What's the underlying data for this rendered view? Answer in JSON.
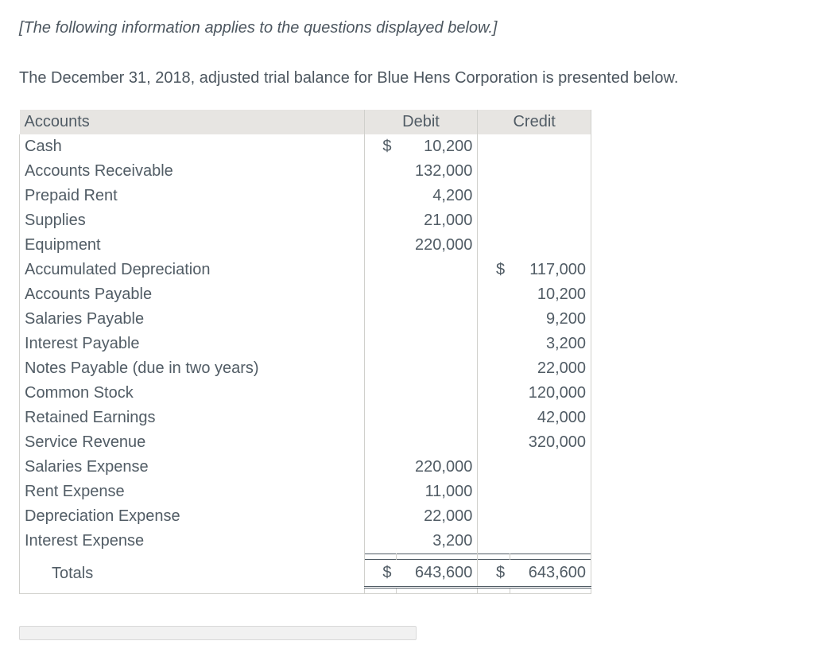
{
  "intro": "[The following information applies to the questions displayed below.]",
  "narrative": "The December 31, 2018, adjusted trial balance for Blue Hens Corporation is presented below.",
  "chart_data": {
    "type": "table",
    "title": "Adjusted Trial Balance",
    "columns": [
      "Accounts",
      "Debit",
      "Credit"
    ],
    "rows": [
      {
        "account": "Cash",
        "debit": 10200,
        "credit": null
      },
      {
        "account": "Accounts Receivable",
        "debit": 132000,
        "credit": null
      },
      {
        "account": "Prepaid Rent",
        "debit": 4200,
        "credit": null
      },
      {
        "account": "Supplies",
        "debit": 21000,
        "credit": null
      },
      {
        "account": "Equipment",
        "debit": 220000,
        "credit": null
      },
      {
        "account": "Accumulated Depreciation",
        "debit": null,
        "credit": 117000
      },
      {
        "account": "Accounts Payable",
        "debit": null,
        "credit": 10200
      },
      {
        "account": "Salaries Payable",
        "debit": null,
        "credit": 9200
      },
      {
        "account": "Interest Payable",
        "debit": null,
        "credit": 3200
      },
      {
        "account": "Notes Payable (due in two years)",
        "debit": null,
        "credit": 22000
      },
      {
        "account": "Common Stock",
        "debit": null,
        "credit": 120000
      },
      {
        "account": "Retained Earnings",
        "debit": null,
        "credit": 42000
      },
      {
        "account": "Service Revenue",
        "debit": null,
        "credit": 320000
      },
      {
        "account": "Salaries Expense",
        "debit": 220000,
        "credit": null
      },
      {
        "account": "Rent Expense",
        "debit": 11000,
        "credit": null
      },
      {
        "account": "Depreciation Expense",
        "debit": 22000,
        "credit": null
      },
      {
        "account": "Interest Expense",
        "debit": 3200,
        "credit": null
      }
    ],
    "totals": {
      "label": "Totals",
      "debit": 643600,
      "credit": 643600
    }
  },
  "header": {
    "accounts": "Accounts",
    "debit": "Debit",
    "credit": "Credit"
  },
  "rows": {
    "r0": {
      "acct": "Cash",
      "dsym": "$",
      "d": "10,200",
      "csym": "",
      "c": ""
    },
    "r1": {
      "acct": "Accounts Receivable",
      "dsym": "",
      "d": "132,000",
      "csym": "",
      "c": ""
    },
    "r2": {
      "acct": "Prepaid Rent",
      "dsym": "",
      "d": "4,200",
      "csym": "",
      "c": ""
    },
    "r3": {
      "acct": "Supplies",
      "dsym": "",
      "d": "21,000",
      "csym": "",
      "c": ""
    },
    "r4": {
      "acct": "Equipment",
      "dsym": "",
      "d": "220,000",
      "csym": "",
      "c": ""
    },
    "r5": {
      "acct": "Accumulated Depreciation",
      "dsym": "",
      "d": "",
      "csym": "$",
      "c": "117,000"
    },
    "r6": {
      "acct": "Accounts Payable",
      "dsym": "",
      "d": "",
      "csym": "",
      "c": "10,200"
    },
    "r7": {
      "acct": "Salaries Payable",
      "dsym": "",
      "d": "",
      "csym": "",
      "c": "9,200"
    },
    "r8": {
      "acct": "Interest Payable",
      "dsym": "",
      "d": "",
      "csym": "",
      "c": "3,200"
    },
    "r9": {
      "acct": "Notes Payable (due in two years)",
      "dsym": "",
      "d": "",
      "csym": "",
      "c": "22,000"
    },
    "r10": {
      "acct": "Common Stock",
      "dsym": "",
      "d": "",
      "csym": "",
      "c": "120,000"
    },
    "r11": {
      "acct": "Retained Earnings",
      "dsym": "",
      "d": "",
      "csym": "",
      "c": "42,000"
    },
    "r12": {
      "acct": "Service Revenue",
      "dsym": "",
      "d": "",
      "csym": "",
      "c": "320,000"
    },
    "r13": {
      "acct": "Salaries Expense",
      "dsym": "",
      "d": "220,000",
      "csym": "",
      "c": ""
    },
    "r14": {
      "acct": "Rent Expense",
      "dsym": "",
      "d": "11,000",
      "csym": "",
      "c": ""
    },
    "r15": {
      "acct": "Depreciation Expense",
      "dsym": "",
      "d": "22,000",
      "csym": "",
      "c": ""
    },
    "r16": {
      "acct": "Interest Expense",
      "dsym": "",
      "d": "3,200",
      "csym": "",
      "c": ""
    }
  },
  "totals": {
    "label": "Totals",
    "dsym": "$",
    "d": "643,600",
    "csym": "$",
    "c": "643,600"
  }
}
